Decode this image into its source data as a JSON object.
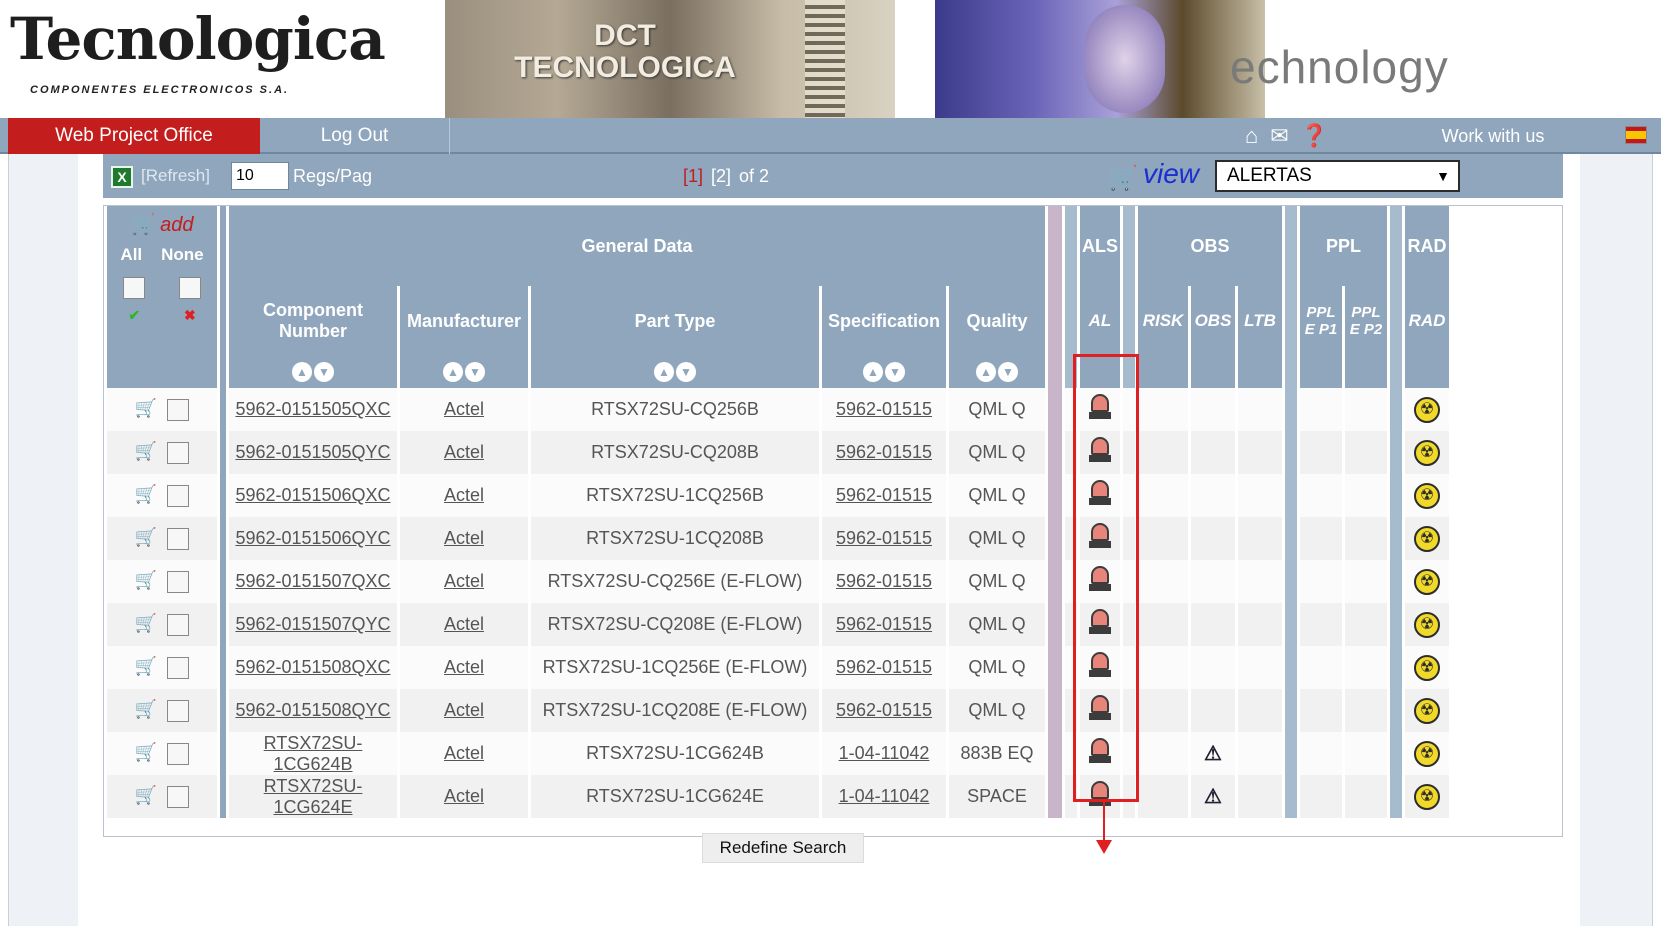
{
  "brand": {
    "logo_main": "Tecnologica",
    "logo_sub": "COMPONENTES ELECTRONICOS S.A.",
    "chip_text": "DCT\nTECNOLOGICA",
    "tech_word": "echnology"
  },
  "nav": {
    "active": "Web Project Office",
    "logout": "Log Out",
    "work": "Work with us",
    "icons": [
      "home-icon",
      "mail-icon",
      "help-icon"
    ]
  },
  "toolbar": {
    "refresh": "[Refresh]",
    "regs_value": "10",
    "regs_label": "Regs/Pag",
    "page_current": "[1]",
    "page_next": "[2]",
    "page_of": "of 2",
    "view_label": "view",
    "view_select": "ALERTAS"
  },
  "header": {
    "add": "add",
    "all": "All",
    "none": "None",
    "general": "General Data",
    "als": "ALS",
    "obs": "OBS",
    "ppl": "PPL",
    "rad": "RAD",
    "cols": {
      "component": "Component Number",
      "manufacturer": "Manufacturer",
      "part_type": "Part Type",
      "specification": "Specification",
      "quality": "Quality",
      "al": "AL",
      "risk": "RISK",
      "obs": "OBS",
      "ltb": "LTB",
      "pplep1": "PPL E P1",
      "pplep2": "PPL E P2",
      "rad": "RAD"
    }
  },
  "rows": [
    {
      "component": "5962-0151505QXC",
      "manufacturer": "Actel",
      "part_type": "RTSX72SU-CQ256B",
      "specification": "5962-01515",
      "quality": "QML Q",
      "obs": false
    },
    {
      "component": "5962-0151505QYC",
      "manufacturer": "Actel",
      "part_type": "RTSX72SU-CQ208B",
      "specification": "5962-01515",
      "quality": "QML Q",
      "obs": false
    },
    {
      "component": "5962-0151506QXC",
      "manufacturer": "Actel",
      "part_type": "RTSX72SU-1CQ256B",
      "specification": "5962-01515",
      "quality": "QML Q",
      "obs": false
    },
    {
      "component": "5962-0151506QYC",
      "manufacturer": "Actel",
      "part_type": "RTSX72SU-1CQ208B",
      "specification": "5962-01515",
      "quality": "QML Q",
      "obs": false
    },
    {
      "component": "5962-0151507QXC",
      "manufacturer": "Actel",
      "part_type": "RTSX72SU-CQ256E (E-FLOW)",
      "specification": "5962-01515",
      "quality": "QML Q",
      "obs": false
    },
    {
      "component": "5962-0151507QYC",
      "manufacturer": "Actel",
      "part_type": "RTSX72SU-CQ208E (E-FLOW)",
      "specification": "5962-01515",
      "quality": "QML Q",
      "obs": false
    },
    {
      "component": "5962-0151508QXC",
      "manufacturer": "Actel",
      "part_type": "RTSX72SU-1CQ256E (E-FLOW)",
      "specification": "5962-01515",
      "quality": "QML Q",
      "obs": false
    },
    {
      "component": "5962-0151508QYC",
      "manufacturer": "Actel",
      "part_type": "RTSX72SU-1CQ208E (E-FLOW)",
      "specification": "5962-01515",
      "quality": "QML Q",
      "obs": false
    },
    {
      "component": "RTSX72SU-1CG624B",
      "manufacturer": "Actel",
      "part_type": "RTSX72SU-1CG624B",
      "specification": "1-04-11042",
      "quality": "883B EQ",
      "obs": true
    },
    {
      "component": "RTSX72SU-1CG624E",
      "manufacturer": "Actel",
      "part_type": "RTSX72SU-1CG624E",
      "specification": "1-04-11042",
      "quality": "SPACE",
      "obs": true
    }
  ],
  "footer": {
    "redefine": "Redefine Search"
  },
  "colors": {
    "nav_bg": "#8fa6bd",
    "nav_active": "#c41d1d",
    "highlight": "#e02020"
  }
}
